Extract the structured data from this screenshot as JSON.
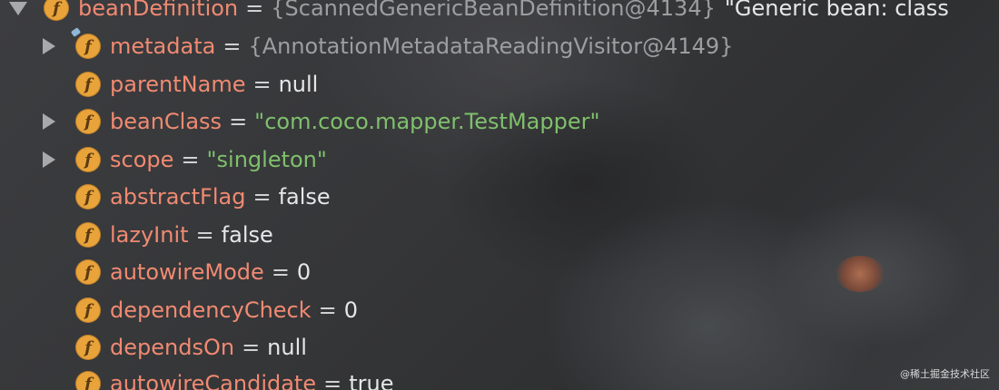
{
  "root": {
    "name": "beanDefinition",
    "value": "{ScannedGenericBeanDefinition@4134}",
    "tail": "\"Generic bean: class"
  },
  "fields": [
    {
      "name": "metadata",
      "value": "{AnnotationMetadataReadingVisitor@4149}",
      "kind": "ref",
      "expandable": true
    },
    {
      "name": "parentName",
      "value": "null",
      "kind": "val",
      "expandable": false
    },
    {
      "name": "beanClass",
      "value": "\"com.coco.mapper.TestMapper\"",
      "kind": "str",
      "expandable": true
    },
    {
      "name": "scope",
      "value": "\"singleton\"",
      "kind": "str",
      "expandable": true
    },
    {
      "name": "abstractFlag",
      "value": "false",
      "kind": "val",
      "expandable": false
    },
    {
      "name": "lazyInit",
      "value": "false",
      "kind": "val",
      "expandable": false
    },
    {
      "name": "autowireMode",
      "value": "0",
      "kind": "val",
      "expandable": false
    },
    {
      "name": "dependencyCheck",
      "value": "0",
      "kind": "val",
      "expandable": false
    },
    {
      "name": "dependsOn",
      "value": "null",
      "kind": "val",
      "expandable": false
    },
    {
      "name": "autowireCandidate",
      "value": "true",
      "kind": "val",
      "expandable": false
    }
  ],
  "icon_letter": "f",
  "equals": "=",
  "watermark": "@稀土掘金技术社区",
  "colors": {
    "field_name": "#f08a72",
    "string_value": "#7fc06c",
    "ref_value": "#9c9ea0",
    "icon_bg": "#e8a33a"
  }
}
